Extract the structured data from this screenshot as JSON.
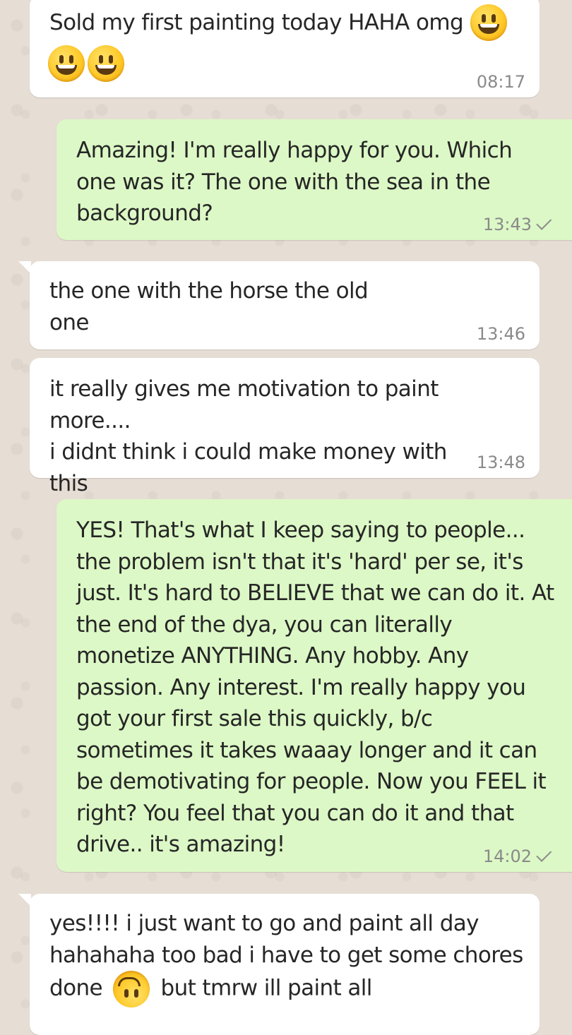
{
  "messages": [
    {
      "direction": "incoming",
      "text": "Sold my first painting today HAHA omg",
      "emojis": [
        "grinning-face-icon",
        "grinning-face-icon",
        "grinning-face-icon"
      ],
      "time": "08:17"
    },
    {
      "direction": "outgoing",
      "text": "Amazing! I'm really happy for you. Which\none was it? The one with the sea in the\nbackground?",
      "time": "13:43",
      "status": "sent"
    },
    {
      "direction": "incoming",
      "text": "the one with the horse the old\none",
      "time": "13:46"
    },
    {
      "direction": "incoming",
      "text": "it really gives me motivation to paint more....\ni didnt think i could make money with\nthis",
      "time": "13:48"
    },
    {
      "direction": "outgoing",
      "text": "YES! That's what I keep saying to people...\nthe problem isn't that it's 'hard' per se, it's\njust. It's hard to BELIEVE that we can do it. At\nthe end of the dya, you can literally\nmonetize ANYTHING. Any hobby. Any\npassion. Any interest. I'm really happy you\ngot your first sale this quickly, b/c\nsometimes it takes waaay longer and it can\nbe demotivating for people. Now you FEEL it\nright? You feel that you can do it and that\ndrive.. it's amazing!",
      "time": "14:02",
      "status": "sent"
    },
    {
      "direction": "incoming",
      "text_before_emoji": "yes!!!! i just want to go and paint all day\nhahahaha too bad i have to get some chores\ndone",
      "emoji": "upside-down-face-icon",
      "text_after_emoji": "but tmrw ill paint all"
    }
  ]
}
